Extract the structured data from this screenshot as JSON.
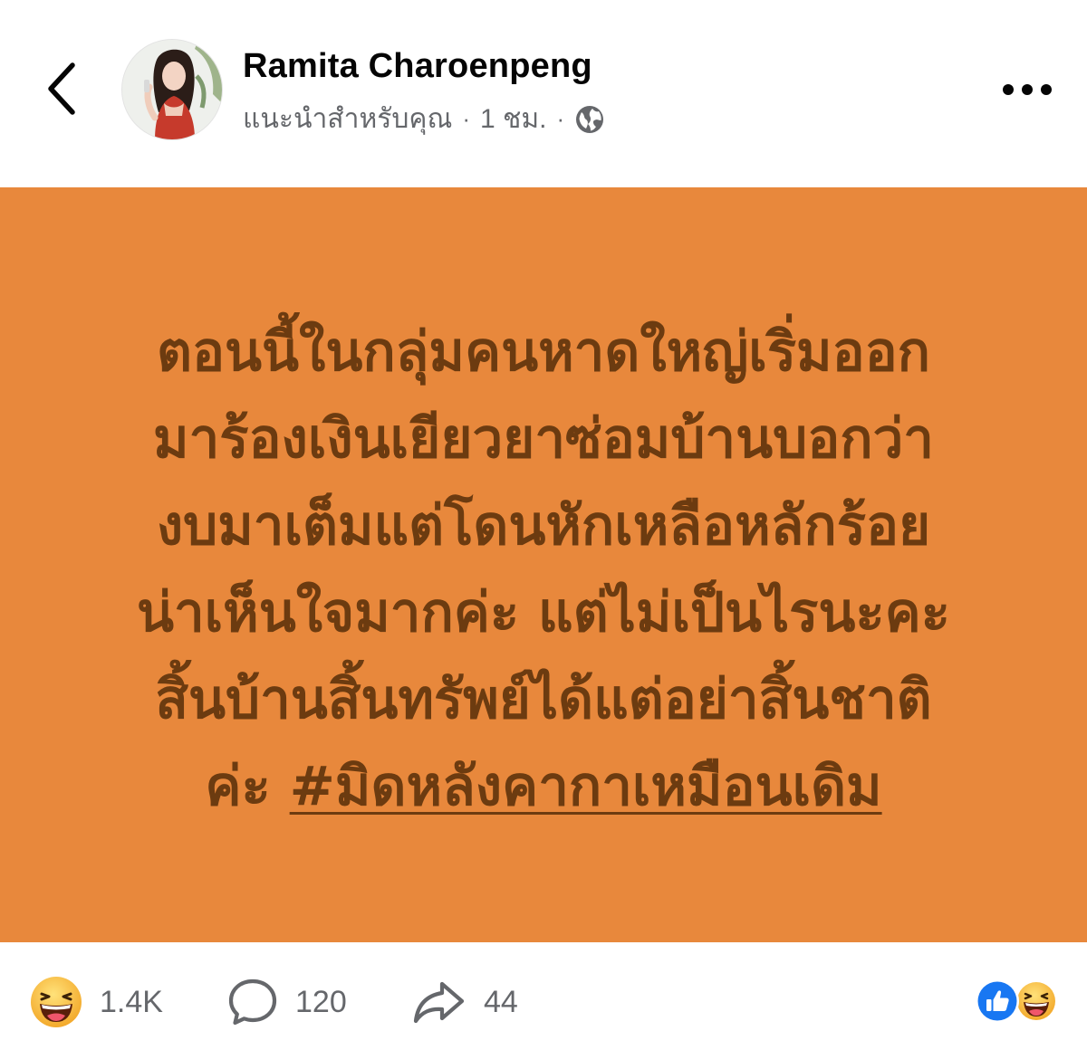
{
  "post": {
    "author": "Ramita Charoenpeng",
    "meta_suggested": "แนะนำสำหรับคุณ",
    "meta_time": "1 ชม.",
    "meta_separator": "·",
    "audience_icon": "globe-icon"
  },
  "card": {
    "background_color": "#e8883c",
    "text_color": "#6c3b10",
    "lines": [
      "ตอนนี้ในกลุ่มคนหาดใหญ่เริ่มออก",
      "มาร้องเงินเยียวยาซ่อมบ้านบอกว่า",
      "งบมาเต็มแต่โดนหักเหลือหลักร้อย",
      "น่าเห็นใจมากค่ะ แต่ไม่เป็นไรนะคะ",
      "สิ้นบ้านสิ้นทรัพย์ได้แต่อย่าสิ้นชาติ"
    ],
    "last_line_prefix": "ค่ะ ",
    "hashtag": "#มิดหลังคากาเหมือนเดิม"
  },
  "actions": {
    "reactions_count": "1.4K",
    "comments_count": "120",
    "shares_count": "44"
  },
  "icons": {
    "back": "chevron-left-icon",
    "more": "more-horizontal-icon",
    "haha": "haha-reaction-icon",
    "comment": "comment-icon",
    "share": "share-icon",
    "like": "like-reaction-icon"
  },
  "colors": {
    "like_blue": "#1877f2",
    "emoji_yellow": "#f7c138",
    "secondary_text": "#65676b"
  }
}
